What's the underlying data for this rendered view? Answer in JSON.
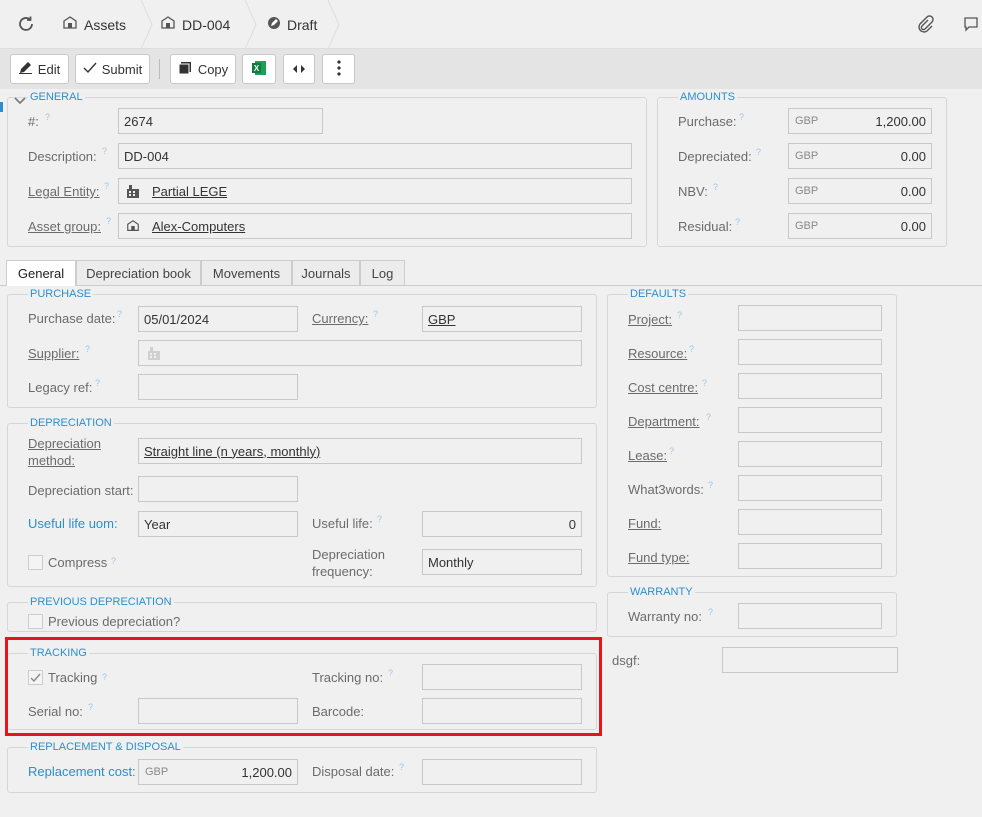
{
  "breadcrumb": {
    "items": [
      "Assets",
      "DD-004",
      "Draft"
    ]
  },
  "toolbar": {
    "edit": "Edit",
    "submit": "Submit",
    "copy": "Copy"
  },
  "general": {
    "legend": "GENERAL",
    "number_label": "#:",
    "number_value": "2674",
    "description_label": "Description:",
    "description_value": "DD-004",
    "legal_entity_label": "Legal Entity:",
    "legal_entity_value": "Partial LEGE",
    "asset_group_label": "Asset group:",
    "asset_group_value": "Alex-Computers"
  },
  "amounts": {
    "legend": "AMOUNTS",
    "currency": "GBP",
    "rows": [
      {
        "label": "Purchase:",
        "value": "1,200.00"
      },
      {
        "label": "Depreciated:",
        "value": "0.00"
      },
      {
        "label": "NBV:",
        "value": "0.00"
      },
      {
        "label": "Residual:",
        "value": "0.00"
      }
    ]
  },
  "tabs": [
    "General",
    "Depreciation book",
    "Movements",
    "Journals",
    "Log"
  ],
  "purchase": {
    "legend": "PURCHASE",
    "purchase_date_label": "Purchase date:",
    "purchase_date_value": "05/01/2024",
    "currency_label": "Currency:",
    "currency_value": "GBP",
    "supplier_label": "Supplier:",
    "legacy_ref_label": "Legacy ref:"
  },
  "depreciation": {
    "legend": "DEPRECIATION",
    "method_label_1": "Depreciation",
    "method_label_2": "method:",
    "method_value": "Straight line (n years, monthly)",
    "start_label": "Depreciation start:",
    "life_uom_label": "Useful life uom:",
    "life_uom_value": "Year",
    "life_label": "Useful life:",
    "life_value": "0",
    "compress_label": "Compress",
    "frequency_label_1": "Depreciation",
    "frequency_label_2": "frequency:",
    "frequency_value": "Monthly"
  },
  "previous": {
    "legend": "PREVIOUS DEPRECIATION",
    "checkbox_label": "Previous depreciation?"
  },
  "tracking": {
    "legend": "TRACKING",
    "tracking_label": "Tracking",
    "tracking_no_label": "Tracking no:",
    "serial_label": "Serial no:",
    "barcode_label": "Barcode:"
  },
  "replacement": {
    "legend": "REPLACEMENT & DISPOSAL",
    "cost_label": "Replacement cost:",
    "cost_currency": "GBP",
    "cost_value": "1,200.00",
    "disposal_label": "Disposal date:"
  },
  "defaults": {
    "legend": "DEFAULTS",
    "rows": [
      "Project:",
      "Resource:",
      "Cost centre:",
      "Department:",
      "Lease:",
      "What3words:",
      "Fund:",
      "Fund type:"
    ]
  },
  "warranty": {
    "legend": "WARRANTY",
    "warranty_no_label": "Warranty no:"
  },
  "extra": {
    "dsgf_label": "dsgf:"
  },
  "colors": {
    "accent": "#2a8fce",
    "highlight": "#e8141b"
  }
}
